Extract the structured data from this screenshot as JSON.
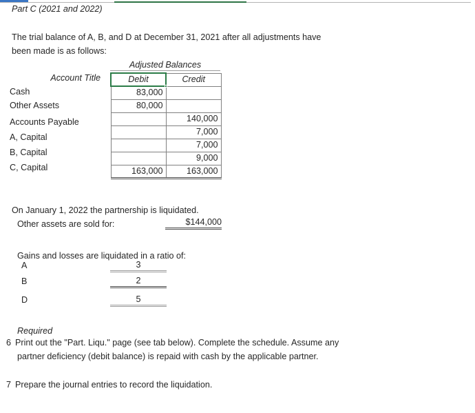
{
  "chrome": {
    "accent_blue": "#3a76c4",
    "accent_green": "#2d7344",
    "rule_color": "#b4b4b4"
  },
  "header": {
    "part_title": "Part C (2021 and 2022)"
  },
  "intro": {
    "line1": "The trial balance of A, B, and D at December 31, 2021 after all adjustments have",
    "line2": "been made is as follows:"
  },
  "trial_balance": {
    "group_header": "Adjusted Balances",
    "row_label_header": "Account Title",
    "columns": [
      "Debit",
      "Credit"
    ],
    "active_cell": "Debit",
    "active_cell_color": "#2a7b46",
    "rows": [
      {
        "label": "Cash",
        "debit": "83,000",
        "credit": ""
      },
      {
        "label": "Other Assets",
        "debit": "80,000",
        "credit": ""
      },
      {
        "label": "Accounts Payable",
        "debit": "",
        "credit": "140,000"
      },
      {
        "label": "A, Capital",
        "debit": "",
        "credit": "7,000"
      },
      {
        "label": "B, Capital",
        "debit": "",
        "credit": "7,000"
      },
      {
        "label": "C, Capital",
        "debit": "",
        "credit": "9,000"
      }
    ],
    "total": {
      "label": "",
      "debit": "163,000",
      "credit": "163,000"
    }
  },
  "liquidation": {
    "line1": "On January 1, 2022 the partnership is liquidated.",
    "line2": "Other assets are sold for:",
    "sale_amount": "$144,000"
  },
  "ratio": {
    "heading": "Gains and losses are liquidated in a ratio of:",
    "rows": [
      {
        "name": "A",
        "value": "3"
      },
      {
        "name": "B",
        "value": "2"
      },
      {
        "name": "D",
        "value": "5"
      }
    ]
  },
  "required": {
    "label": "Required",
    "items": [
      {
        "number": "6",
        "line1": "Print out the \"Part. Liqu.\" page (see tab below). Complete the schedule. Assume any",
        "line2": "partner deficiency (debit balance) is repaid with cash by the applicable partner."
      },
      {
        "number": "7",
        "line1": "Prepare the journal entries to record the liquidation.",
        "line2": ""
      }
    ]
  }
}
